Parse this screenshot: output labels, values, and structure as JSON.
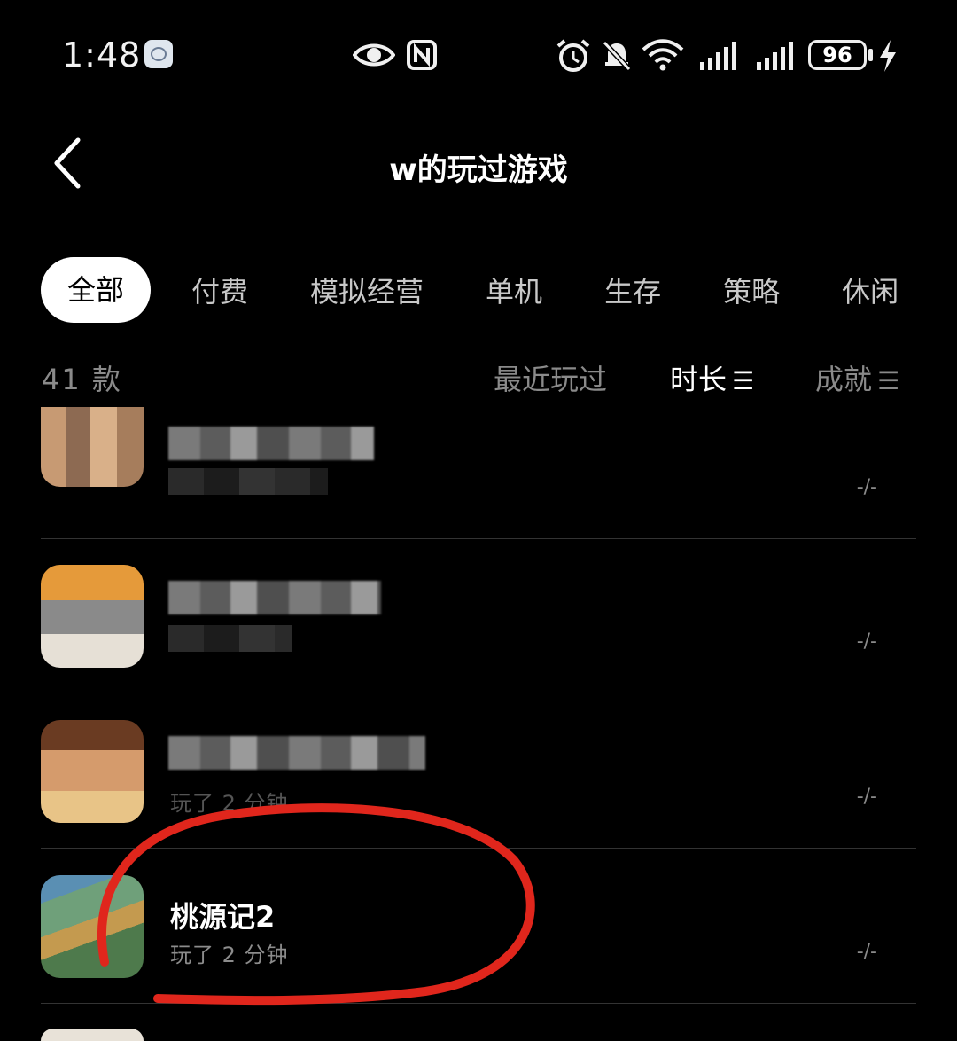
{
  "status": {
    "time": "1:48",
    "battery": "96"
  },
  "header": {
    "title": "w的玩过游戏"
  },
  "tabs": [
    "全部",
    "付费",
    "模拟经营",
    "单机",
    "生存",
    "策略",
    "休闲"
  ],
  "list_meta": {
    "count": "41 款",
    "sort_recent": "最近玩过",
    "sort_duration": "时长",
    "sort_achievement": "成就",
    "sort_glyph": "☰"
  },
  "games": [
    {
      "name": "",
      "subtitle": "",
      "value": "-/-"
    },
    {
      "name": "",
      "subtitle": "",
      "value": "-/-"
    },
    {
      "name": "",
      "subtitle": "玩了 2 分钟",
      "value": "-/-"
    },
    {
      "name": "桃源记2",
      "subtitle": "玩了 2 分钟",
      "value": "-/-"
    }
  ],
  "colors": {
    "annotation": "#e0261c",
    "background": "#000000"
  }
}
